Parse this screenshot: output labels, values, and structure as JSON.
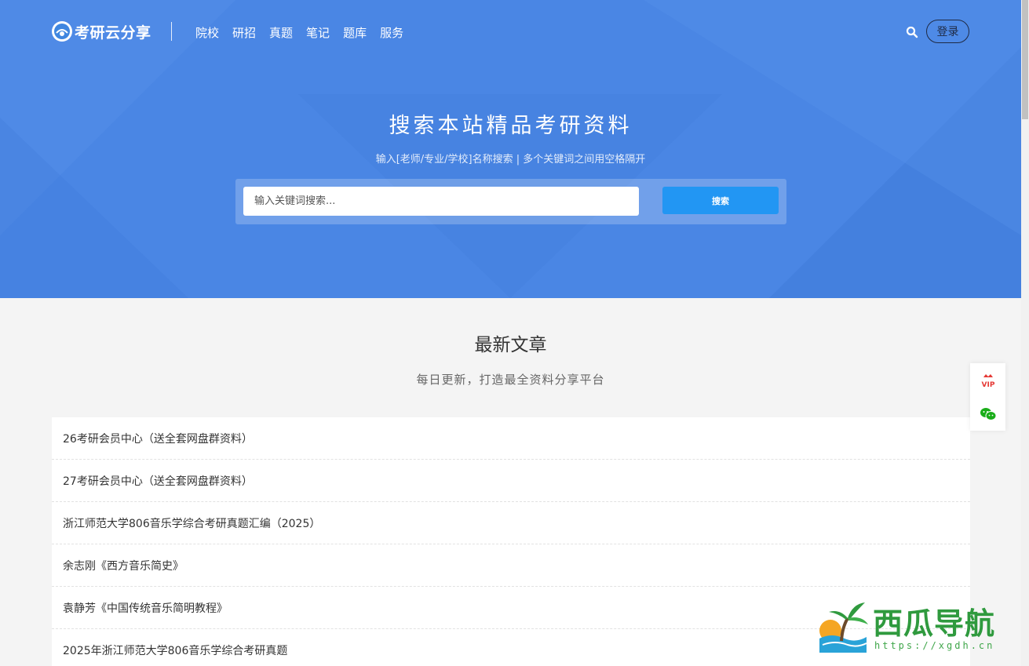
{
  "header": {
    "logo_text": "考研云分享",
    "nav": [
      "院校",
      "研招",
      "真题",
      "笔记",
      "题库",
      "服务"
    ],
    "login_label": "登录"
  },
  "hero": {
    "title": "搜索本站精品考研资料",
    "subtitle": "输入[老师/专业/学校]名称搜索 | 多个关键词之间用空格隔开",
    "search_placeholder": "输入关键词搜索...",
    "search_button": "搜索"
  },
  "latest": {
    "title": "最新文章",
    "subtitle": "每日更新，打造最全资料分享平台",
    "items": [
      "26考研会员中心（送全套网盘群资料）",
      "27考研会员中心（送全套网盘群资料）",
      "浙江师范大学806音乐学综合考研真题汇编（2025）",
      "余志刚《西方音乐简史》",
      "袁静芳《中国传统音乐简明教程》",
      "2025年浙江师范大学806音乐学综合考研真题"
    ]
  },
  "side_tools": {
    "vip_label": "VIP"
  },
  "watermark": {
    "title": "西瓜导航",
    "url": "https://xgdh.cn"
  },
  "colors": {
    "hero_bg": "#4a86e4",
    "search_button": "#2296f3",
    "page_bg": "#f4f4f4",
    "watermark_green": "#2f9a3e"
  }
}
